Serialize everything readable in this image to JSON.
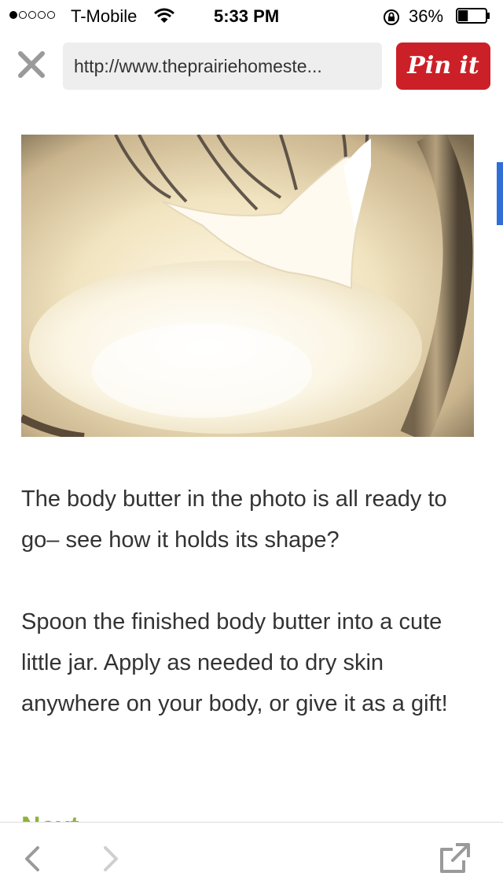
{
  "status_bar": {
    "carrier": "T-Mobile",
    "time": "5:33 PM",
    "battery_percent": "36%",
    "signal_bars_filled": 1,
    "signal_bars_total": 5,
    "battery_level": 0.36
  },
  "browser": {
    "url": "http://www.theprairiehomeste...",
    "pin_button_label": "Pin it"
  },
  "article": {
    "paragraphs": [
      "The body butter in the photo is all ready to go– see how it holds its shape?",
      "Spoon the finished body butter into a cute little jar. Apply as needed to dry skin anywhere on your body, or give it as a gift!"
    ],
    "next_heading": "Next"
  },
  "colors": {
    "pin_red": "#cb2027",
    "heading_green": "#8db23a",
    "scroll_blue": "#2f6fd6"
  },
  "icons": {
    "close": "close-icon",
    "back": "chevron-left-icon",
    "forward": "chevron-right-icon",
    "share": "external-link-icon"
  }
}
